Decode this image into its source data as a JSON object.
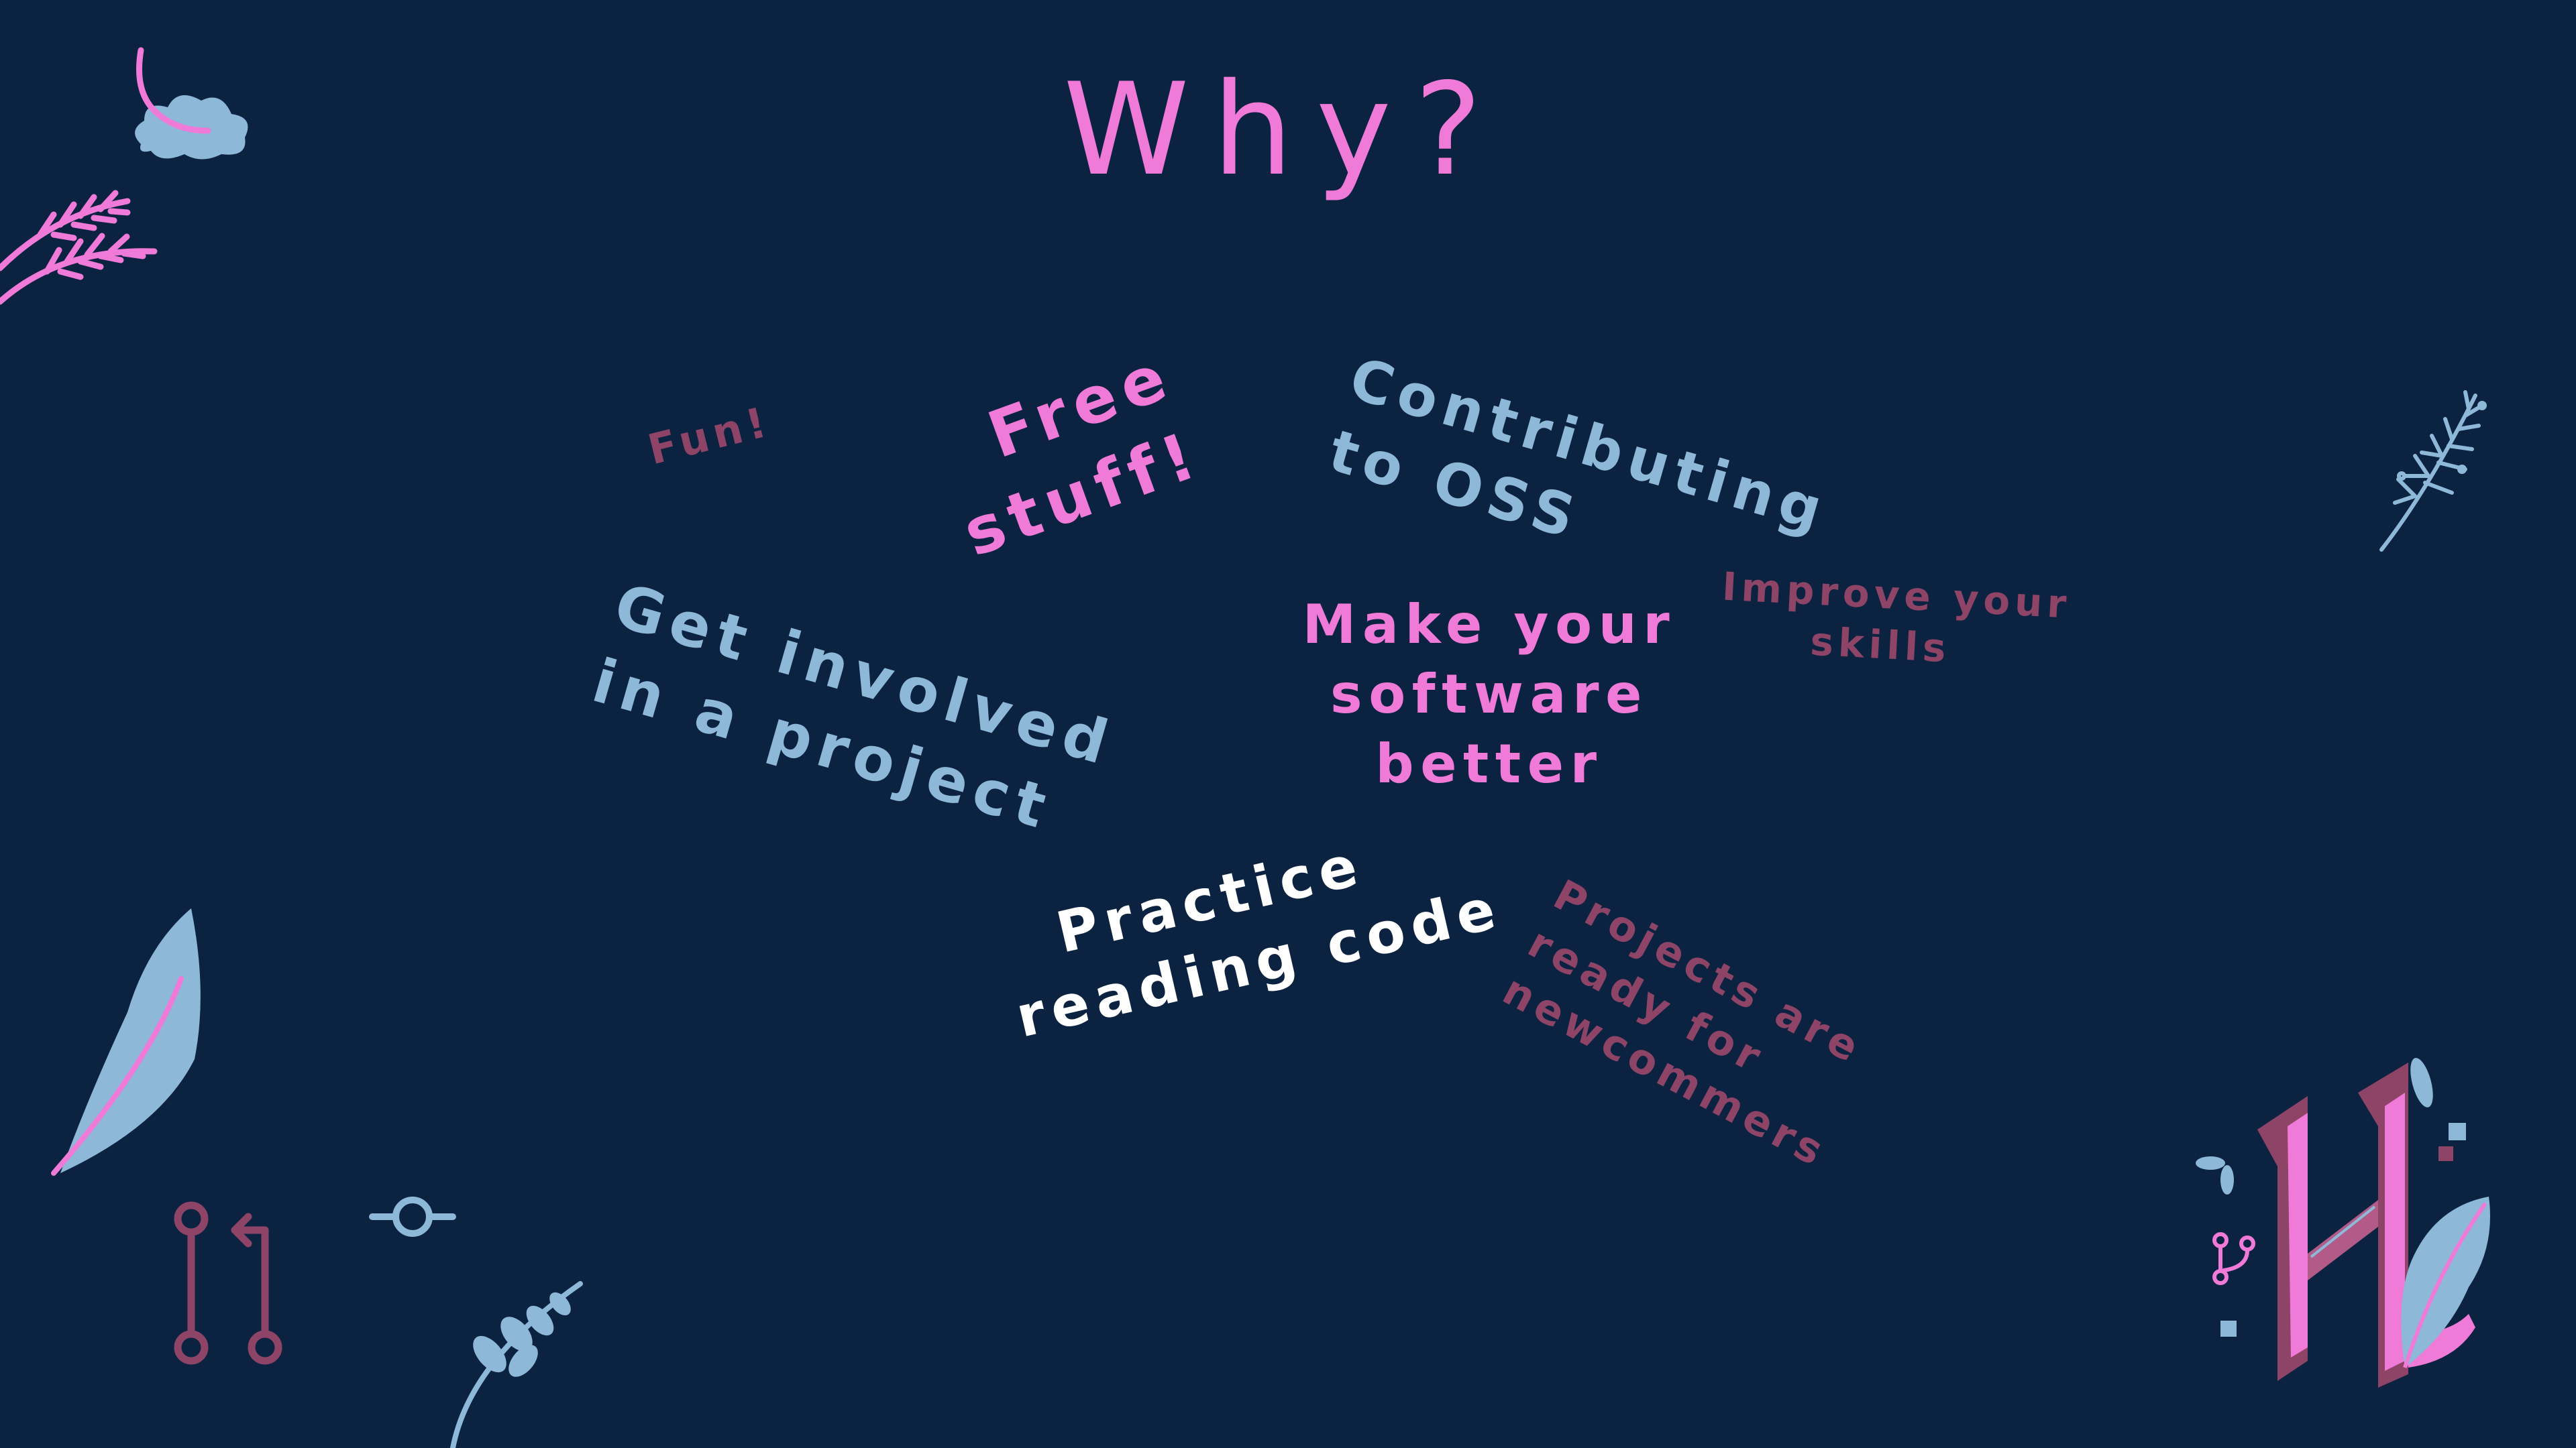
{
  "slide": {
    "title": "Why?",
    "colors": {
      "background": "#0b2341",
      "pink": "#f07ad8",
      "light_blue": "#8db8d8",
      "mauve": "#8d4466",
      "white": "#ffffff"
    }
  },
  "phrases": {
    "fun": "Fun!",
    "free_stuff": [
      "Free",
      "stuff!"
    ],
    "contributing": [
      "Contributing",
      "to OSS"
    ],
    "get_involved": [
      "Get involved",
      "in a project"
    ],
    "make_better": [
      "Make your",
      "software",
      "better"
    ],
    "improve_skills": [
      "Improve your",
      "skills"
    ],
    "practice_reading": [
      "Practice",
      "reading code"
    ],
    "projects_ready": [
      "Projects are",
      "ready for",
      "newcommers"
    ]
  },
  "icons": {
    "top_left": [
      "cloud-icon",
      "feather-icon",
      "wheat-sprig-icon"
    ],
    "right": [
      "fern-sprig-icon"
    ],
    "bottom_left": [
      "leaf-icon",
      "pull-request-icon",
      "git-commit-icon",
      "herb-sprig-icon"
    ],
    "bottom_right": [
      "hacktoberfest-logo-icon"
    ]
  }
}
